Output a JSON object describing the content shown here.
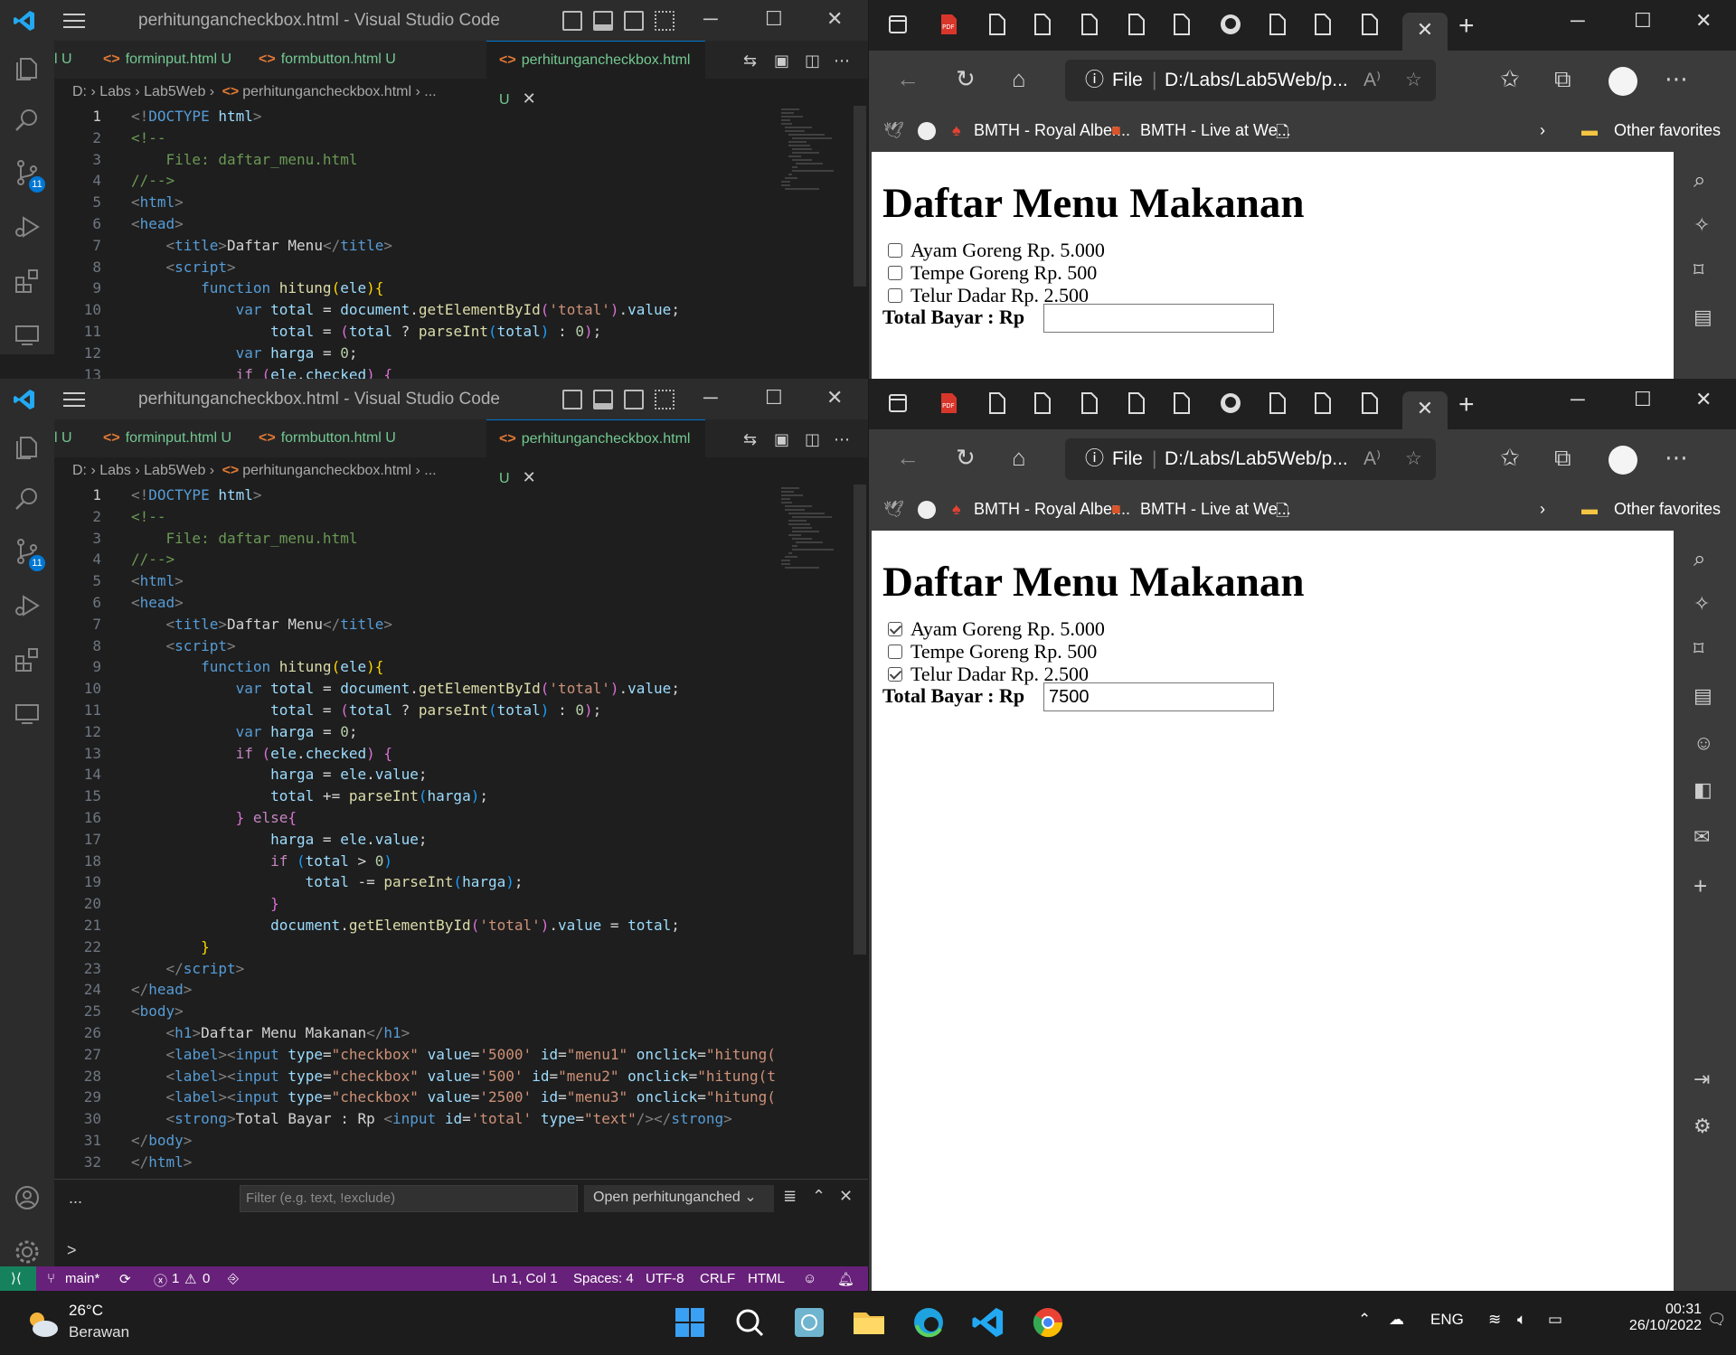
{
  "vscode": {
    "title": "perhitungancheckbox.html - Visual Studio Code",
    "tabs": [
      {
        "label": "l U"
      },
      {
        "label": "forminput.html U"
      },
      {
        "label": "formbutton.html U"
      },
      {
        "label": "perhitungancheckbox.html U"
      }
    ],
    "breadcrumb": [
      "D:",
      "Labs",
      "Lab5Web",
      "perhitungancheckbox.html",
      "..."
    ],
    "panel": {
      "more": "...",
      "filter_placeholder": "Filter (e.g. text, !exclude)",
      "open_select": "Open perhitunganched",
      "prompt": ">"
    },
    "status": {
      "branch": "main*",
      "errors": "1",
      "warnings": "0",
      "position": "Ln 1, Col 1",
      "spaces": "Spaces: 4",
      "encoding": "UTF-8",
      "eol": "CRLF",
      "language": "HTML"
    },
    "activity_badge": "11",
    "code_lines": [
      [
        [
          "pn",
          "<!"
        ],
        [
          "tg",
          "DOCTYPE"
        ],
        [
          "tx",
          " "
        ],
        [
          "at",
          "html"
        ],
        [
          "pn",
          ">"
        ]
      ],
      [
        [
          "cm",
          "<!--"
        ]
      ],
      [
        [
          "cm",
          "    File: daftar_menu.html"
        ]
      ],
      [
        [
          "cm",
          "//-->"
        ]
      ],
      [
        [
          "pn",
          "<"
        ],
        [
          "tg",
          "html"
        ],
        [
          "pn",
          ">"
        ]
      ],
      [
        [
          "pn",
          "<"
        ],
        [
          "tg",
          "head"
        ],
        [
          "pn",
          ">"
        ]
      ],
      [
        [
          "tx",
          "    "
        ],
        [
          "pn",
          "<"
        ],
        [
          "tg",
          "title"
        ],
        [
          "pn",
          ">"
        ],
        [
          "tx",
          "Daftar Menu"
        ],
        [
          "pn",
          "</"
        ],
        [
          "tg",
          "title"
        ],
        [
          "pn",
          ">"
        ]
      ],
      [
        [
          "tx",
          "    "
        ],
        [
          "pn",
          "<"
        ],
        [
          "tg",
          "script"
        ],
        [
          "pn",
          ">"
        ]
      ],
      [
        [
          "tx",
          "        "
        ],
        [
          "kw",
          "function"
        ],
        [
          "tx",
          " "
        ],
        [
          "fn",
          "hitung"
        ],
        [
          "by",
          "("
        ],
        [
          "vr",
          "ele"
        ],
        [
          "by",
          ")"
        ],
        [
          "by",
          "{"
        ]
      ],
      [
        [
          "tx",
          "            "
        ],
        [
          "kw",
          "var"
        ],
        [
          "tx",
          " "
        ],
        [
          "vr",
          "total"
        ],
        [
          "tx",
          " = "
        ],
        [
          "vr",
          "document"
        ],
        [
          "tx",
          "."
        ],
        [
          "fn",
          "getElementById"
        ],
        [
          "bp",
          "("
        ],
        [
          "st",
          "'total'"
        ],
        [
          "bp",
          ")"
        ],
        [
          "tx",
          "."
        ],
        [
          "vr",
          "value"
        ],
        [
          "tx",
          ";"
        ]
      ],
      [
        [
          "tx",
          "                "
        ],
        [
          "vr",
          "total"
        ],
        [
          "tx",
          " = "
        ],
        [
          "bp",
          "("
        ],
        [
          "vr",
          "total"
        ],
        [
          "tx",
          " ? "
        ],
        [
          "fn",
          "parseInt"
        ],
        [
          "bb",
          "("
        ],
        [
          "vr",
          "total"
        ],
        [
          "bb",
          ")"
        ],
        [
          "tx",
          " : "
        ],
        [
          "nm",
          "0"
        ],
        [
          "bp",
          ")"
        ],
        [
          "tx",
          ";"
        ]
      ],
      [
        [
          "tx",
          "            "
        ],
        [
          "kw",
          "var"
        ],
        [
          "tx",
          " "
        ],
        [
          "vr",
          "harga"
        ],
        [
          "tx",
          " = "
        ],
        [
          "nm",
          "0"
        ],
        [
          "tx",
          ";"
        ]
      ],
      [
        [
          "tx",
          "            "
        ],
        [
          "ck",
          "if"
        ],
        [
          "tx",
          " "
        ],
        [
          "bp",
          "("
        ],
        [
          "vr",
          "ele"
        ],
        [
          "tx",
          "."
        ],
        [
          "vr",
          "checked"
        ],
        [
          "bp",
          ")"
        ],
        [
          "tx",
          " "
        ],
        [
          "bp",
          "{"
        ]
      ],
      [
        [
          "tx",
          "                "
        ],
        [
          "vr",
          "harga"
        ],
        [
          "tx",
          " = "
        ],
        [
          "vr",
          "ele"
        ],
        [
          "tx",
          "."
        ],
        [
          "vr",
          "value"
        ],
        [
          "tx",
          ";"
        ]
      ],
      [
        [
          "tx",
          "                "
        ],
        [
          "vr",
          "total"
        ],
        [
          "tx",
          " += "
        ],
        [
          "fn",
          "parseInt"
        ],
        [
          "bb",
          "("
        ],
        [
          "vr",
          "harga"
        ],
        [
          "bb",
          ")"
        ],
        [
          "tx",
          ";"
        ]
      ],
      [
        [
          "tx",
          "            "
        ],
        [
          "bp",
          "}"
        ],
        [
          "tx",
          " "
        ],
        [
          "ck",
          "else"
        ],
        [
          "bp",
          "{"
        ]
      ],
      [
        [
          "tx",
          "                "
        ],
        [
          "vr",
          "harga"
        ],
        [
          "tx",
          " = "
        ],
        [
          "vr",
          "ele"
        ],
        [
          "tx",
          "."
        ],
        [
          "vr",
          "value"
        ],
        [
          "tx",
          ";"
        ]
      ],
      [
        [
          "tx",
          "                "
        ],
        [
          "ck",
          "if"
        ],
        [
          "tx",
          " "
        ],
        [
          "bb",
          "("
        ],
        [
          "vr",
          "total"
        ],
        [
          "tx",
          " > "
        ],
        [
          "nm",
          "0"
        ],
        [
          "bb",
          ")"
        ]
      ],
      [
        [
          "tx",
          "                    "
        ],
        [
          "vr",
          "total"
        ],
        [
          "tx",
          " -= "
        ],
        [
          "fn",
          "parseInt"
        ],
        [
          "bb",
          "("
        ],
        [
          "vr",
          "harga"
        ],
        [
          "bb",
          ")"
        ],
        [
          "tx",
          ";"
        ]
      ],
      [
        [
          "tx",
          "                "
        ],
        [
          "bp",
          "}"
        ]
      ],
      [
        [
          "tx",
          "                "
        ],
        [
          "vr",
          "document"
        ],
        [
          "tx",
          "."
        ],
        [
          "fn",
          "getElementById"
        ],
        [
          "bp",
          "("
        ],
        [
          "st",
          "'total'"
        ],
        [
          "bp",
          ")"
        ],
        [
          "tx",
          "."
        ],
        [
          "vr",
          "value"
        ],
        [
          "tx",
          " = "
        ],
        [
          "vr",
          "total"
        ],
        [
          "tx",
          ";"
        ]
      ],
      [
        [
          "tx",
          "        "
        ],
        [
          "by",
          "}"
        ]
      ],
      [
        [
          "tx",
          "    "
        ],
        [
          "pn",
          "</"
        ],
        [
          "tg",
          "script"
        ],
        [
          "pn",
          ">"
        ]
      ],
      [
        [
          "pn",
          "</"
        ],
        [
          "tg",
          "head"
        ],
        [
          "pn",
          ">"
        ]
      ],
      [
        [
          "pn",
          "<"
        ],
        [
          "tg",
          "body"
        ],
        [
          "pn",
          ">"
        ]
      ],
      [
        [
          "tx",
          "    "
        ],
        [
          "pn",
          "<"
        ],
        [
          "tg",
          "h1"
        ],
        [
          "pn",
          ">"
        ],
        [
          "tx",
          "Daftar Menu Makanan"
        ],
        [
          "pn",
          "</"
        ],
        [
          "tg",
          "h1"
        ],
        [
          "pn",
          ">"
        ]
      ],
      [
        [
          "tx",
          "    "
        ],
        [
          "pn",
          "<"
        ],
        [
          "tg",
          "label"
        ],
        [
          "pn",
          "><"
        ],
        [
          "tg",
          "input"
        ],
        [
          "tx",
          " "
        ],
        [
          "at",
          "type"
        ],
        [
          "tx",
          "="
        ],
        [
          "st",
          "\"checkbox\""
        ],
        [
          "tx",
          " "
        ],
        [
          "at",
          "value"
        ],
        [
          "tx",
          "="
        ],
        [
          "st",
          "'5000'"
        ],
        [
          "tx",
          " "
        ],
        [
          "at",
          "id"
        ],
        [
          "tx",
          "="
        ],
        [
          "st",
          "\"menu1\""
        ],
        [
          "tx",
          " "
        ],
        [
          "at",
          "onclick"
        ],
        [
          "tx",
          "="
        ],
        [
          "st",
          "\"hitung("
        ]
      ],
      [
        [
          "tx",
          "    "
        ],
        [
          "pn",
          "<"
        ],
        [
          "tg",
          "label"
        ],
        [
          "pn",
          "><"
        ],
        [
          "tg",
          "input"
        ],
        [
          "tx",
          " "
        ],
        [
          "at",
          "type"
        ],
        [
          "tx",
          "="
        ],
        [
          "st",
          "\"checkbox\""
        ],
        [
          "tx",
          " "
        ],
        [
          "at",
          "value"
        ],
        [
          "tx",
          "="
        ],
        [
          "st",
          "'500'"
        ],
        [
          "tx",
          " "
        ],
        [
          "at",
          "id"
        ],
        [
          "tx",
          "="
        ],
        [
          "st",
          "\"menu2\""
        ],
        [
          "tx",
          " "
        ],
        [
          "at",
          "onclick"
        ],
        [
          "tx",
          "="
        ],
        [
          "st",
          "\"hitung(t"
        ]
      ],
      [
        [
          "tx",
          "    "
        ],
        [
          "pn",
          "<"
        ],
        [
          "tg",
          "label"
        ],
        [
          "pn",
          "><"
        ],
        [
          "tg",
          "input"
        ],
        [
          "tx",
          " "
        ],
        [
          "at",
          "type"
        ],
        [
          "tx",
          "="
        ],
        [
          "st",
          "\"checkbox\""
        ],
        [
          "tx",
          " "
        ],
        [
          "at",
          "value"
        ],
        [
          "tx",
          "="
        ],
        [
          "st",
          "'2500'"
        ],
        [
          "tx",
          " "
        ],
        [
          "at",
          "id"
        ],
        [
          "tx",
          "="
        ],
        [
          "st",
          "\"menu3\""
        ],
        [
          "tx",
          " "
        ],
        [
          "at",
          "onclick"
        ],
        [
          "tx",
          "="
        ],
        [
          "st",
          "\"hitung("
        ]
      ],
      [
        [
          "tx",
          "    "
        ],
        [
          "pn",
          "<"
        ],
        [
          "tg",
          "strong"
        ],
        [
          "pn",
          ">"
        ],
        [
          "tx",
          "Total Bayar : Rp "
        ],
        [
          "pn",
          "<"
        ],
        [
          "tg",
          "input"
        ],
        [
          "tx",
          " "
        ],
        [
          "at",
          "id"
        ],
        [
          "tx",
          "="
        ],
        [
          "st",
          "'total'"
        ],
        [
          "tx",
          " "
        ],
        [
          "at",
          "type"
        ],
        [
          "tx",
          "="
        ],
        [
          "st",
          "\"text\""
        ],
        [
          "pn",
          "/></"
        ],
        [
          "tg",
          "strong"
        ],
        [
          "pn",
          ">"
        ]
      ],
      [
        [
          "pn",
          "</"
        ],
        [
          "tg",
          "body"
        ],
        [
          "pn",
          ">"
        ]
      ],
      [
        [
          "pn",
          "</"
        ],
        [
          "tg",
          "html"
        ],
        [
          "pn",
          ">"
        ]
      ]
    ]
  },
  "edge": {
    "address_prefix": "File",
    "address": "D:/Labs/Lab5Web/p...",
    "favorites": {
      "fav1": "BMTH - Royal Alber...",
      "fav2": "BMTH - Live at We...",
      "other": "Other favorites"
    },
    "close_tab": "✕",
    "new_tab": "+"
  },
  "page_before": {
    "heading": "Daftar Menu Makanan",
    "items": [
      {
        "label": "Ayam Goreng Rp. 5.000",
        "checked": false
      },
      {
        "label": "Tempe Goreng Rp. 500",
        "checked": false
      },
      {
        "label": "Telur Dadar Rp. 2.500",
        "checked": false
      }
    ],
    "total_label": "Total Bayar : Rp",
    "total_value": ""
  },
  "page_after": {
    "heading": "Daftar Menu Makanan",
    "items": [
      {
        "label": "Ayam Goreng Rp. 5.000",
        "checked": true
      },
      {
        "label": "Tempe Goreng Rp. 500",
        "checked": false
      },
      {
        "label": "Telur Dadar Rp. 2.500",
        "checked": true
      }
    ],
    "total_label": "Total Bayar : Rp",
    "total_value": "7500"
  },
  "taskbar": {
    "temperature": "26°C",
    "condition": "Berawan",
    "language": "ENG",
    "time": "00:31",
    "date": "26/10/2022"
  },
  "colors": {
    "vscode_status": "#68217a",
    "remote": "#16825d",
    "accent": "#0078d4"
  }
}
